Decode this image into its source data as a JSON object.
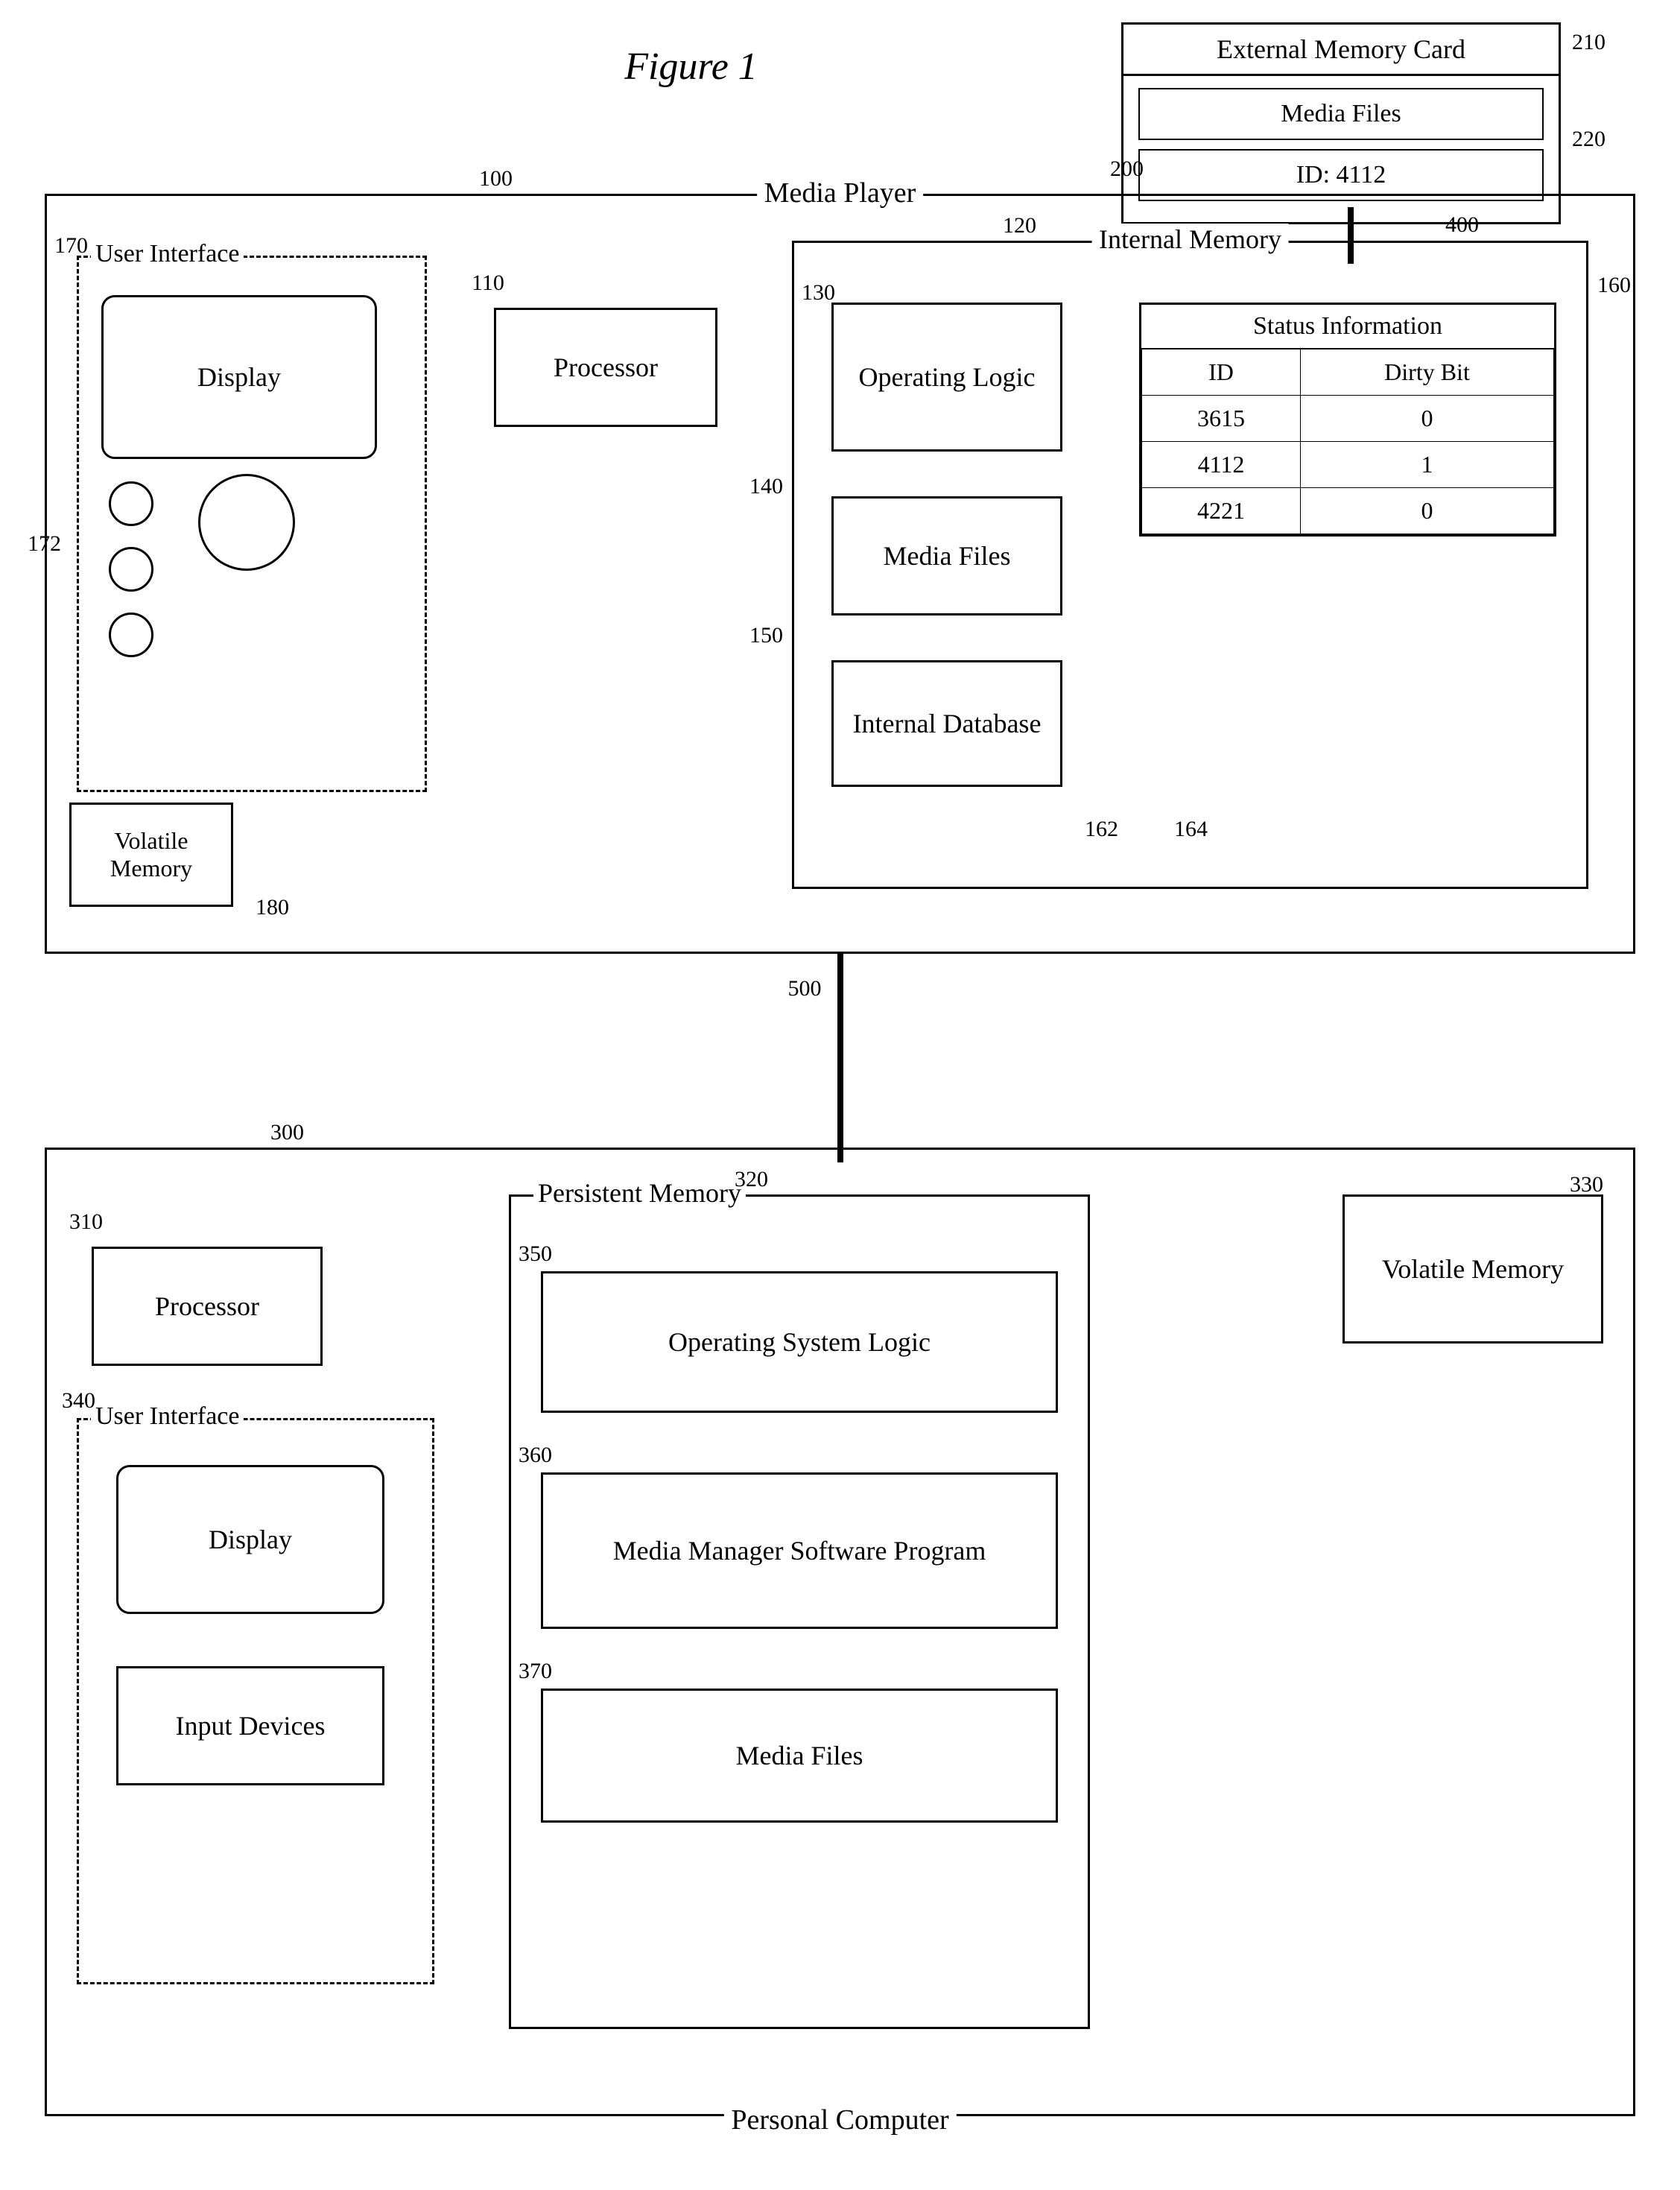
{
  "figure": {
    "title": "Figure 1"
  },
  "annotations": {
    "ext_memory_card_num": "210",
    "media_files_card_num": "220",
    "arrow_200": "200",
    "arrow_400": "400",
    "arrow_100": "100",
    "arrow_110": "110",
    "arrow_120": "120",
    "arrow_130": "130",
    "arrow_140": "140",
    "arrow_150": "150",
    "arrow_160": "160",
    "arrow_162": "162",
    "arrow_164": "164",
    "arrow_170": "170",
    "arrow_172": "172",
    "arrow_180": "180",
    "arrow_300": "300",
    "arrow_310": "310",
    "arrow_320": "320",
    "arrow_330": "330",
    "arrow_340": "340",
    "arrow_350": "350",
    "arrow_360": "360",
    "arrow_370": "370",
    "arrow_500": "500"
  },
  "ext_memory_card": {
    "title": "External Memory Card",
    "media_files_label": "Media Files",
    "id_label": "ID: 4112"
  },
  "media_player": {
    "title": "Media Player",
    "user_interface": {
      "label": "User Interface",
      "display_label": "Display"
    },
    "volatile_memory_label": "Volatile Memory",
    "processor_label": "Processor",
    "internal_memory": {
      "label": "Internal Memory",
      "operating_logic_label": "Operating Logic",
      "media_files_label": "Media Files",
      "internal_database_label": "Internal Database",
      "status_information": {
        "title": "Status Information",
        "col_id": "ID",
        "col_dirty": "Dirty Bit",
        "rows": [
          {
            "id": "3615",
            "dirty": "0"
          },
          {
            "id": "4112",
            "dirty": "1"
          },
          {
            "id": "4221",
            "dirty": "0"
          }
        ]
      }
    }
  },
  "personal_computer": {
    "title": "Personal Computer",
    "processor_label": "Processor",
    "user_interface": {
      "label": "User Interface",
      "display_label": "Display",
      "input_devices_label": "Input Devices"
    },
    "persistent_memory": {
      "label": "Persistent Memory",
      "os_logic_label": "Operating System Logic",
      "media_manager_label": "Media Manager Software Program",
      "media_files_label": "Media Files"
    },
    "volatile_memory_label": "Volatile Memory"
  },
  "connection": {
    "label": "500"
  }
}
